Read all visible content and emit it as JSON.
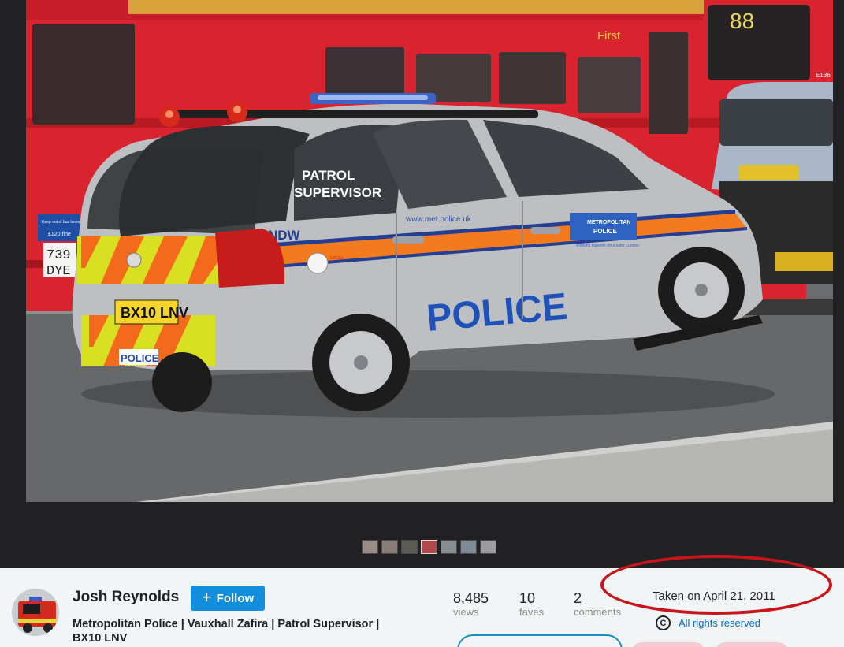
{
  "owner": {
    "name": "Josh Reynolds",
    "follow_label": "Follow"
  },
  "photo": {
    "title": "Metropolitan Police | Vauxhall Zafira | Patrol Supervisor | BX10 LNV",
    "taken": "Taken on April 21, 2011",
    "license": "All rights reserved",
    "license_icon": "copyright-icon",
    "scene": {
      "bus_route": "88",
      "bus_operator": "First",
      "bus_fleet": "E136",
      "bus_sign_left": "Keep out of bus lanes",
      "bus_sign_fine": "£120 fine",
      "bus_plate": [
        "739",
        "DYE"
      ],
      "car_plate": "BX10 LNV",
      "car_code": "NDW",
      "car_door_text": [
        "PATROL",
        "SUPERVISOR"
      ],
      "car_livery": "POLICE",
      "car_rear_badge": "POLICE",
      "car_url": "www.met.police.uk",
      "car_force": [
        "METROPOLITAN",
        "POLICE"
      ],
      "car_slogan": "Working together for a safer London",
      "car_fuel": "DIESEL"
    }
  },
  "stats": [
    {
      "value": "8,485",
      "label": "views"
    },
    {
      "value": "10",
      "label": "faves"
    },
    {
      "value": "2",
      "label": "comments"
    }
  ],
  "colors": {
    "accent": "#128fdc",
    "link": "#006add",
    "annotation": "#c8151b",
    "bus_red": "#d9232e",
    "stripe_orange": "#f47a20",
    "chevron_yellow": "#d8e021"
  }
}
